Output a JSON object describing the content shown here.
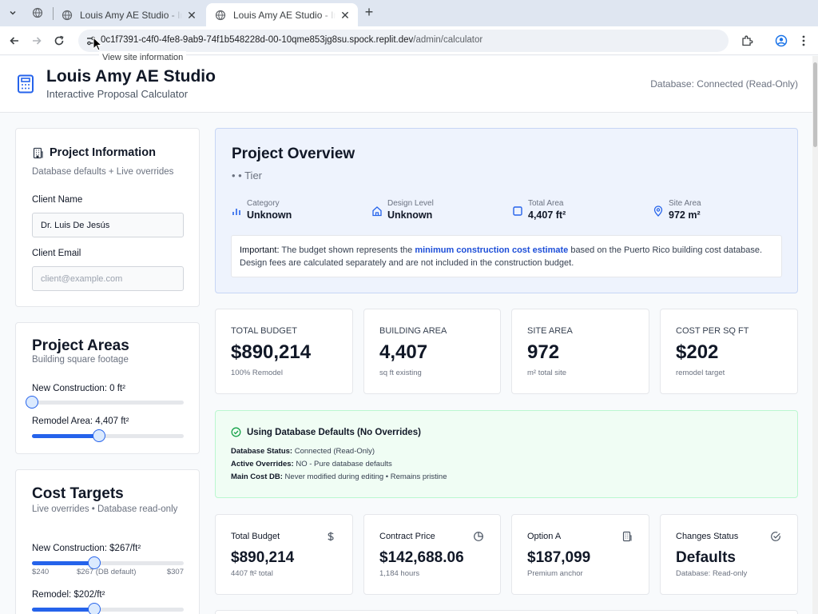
{
  "browser": {
    "tabs": [
      {
        "title": "Louis Amy AE Studio - Intera"
      },
      {
        "title": "Louis Amy AE Studio - Intera"
      }
    ],
    "url_host": "0c1f7391-c4f0-4fe8-9ab9-74f1b548228d-00-10qme853jg8su.spock.replit.dev",
    "url_path": "/admin/calculator",
    "tooltip": "View site information"
  },
  "header": {
    "title": "Louis Amy AE Studio",
    "subtitle": "Interactive Proposal Calculator",
    "db_status": "Database: Connected (Read-Only)"
  },
  "project_info": {
    "heading": "Project Information",
    "subheading": "Database defaults + Live overrides",
    "client_name_label": "Client Name",
    "client_name_value": "Dr. Luis De Jesús",
    "client_email_label": "Client Email",
    "client_email_placeholder": "client@example.com"
  },
  "project_areas": {
    "heading": "Project Areas",
    "subheading": "Building square footage",
    "new_construction_label": "New Construction: 0 ft²",
    "new_construction_fraction": 0.0,
    "remodel_label": "Remodel Area: 4,407 ft²",
    "remodel_fraction": 0.44
  },
  "cost_targets": {
    "heading": "Cost Targets",
    "subheading": "Live overrides • Database read-only",
    "new_construction_label": "New Construction: $267/ft²",
    "new_construction_fraction": 0.41,
    "ticks": [
      "$240",
      "$267 (DB default)",
      "$307"
    ],
    "remodel_label": "Remodel: $202/ft²",
    "remodel_fraction": 0.41
  },
  "overview": {
    "title": "Project Overview",
    "tier": "• • Tier",
    "stats": [
      {
        "label": "Category",
        "value": "Unknown",
        "icon": "bar-chart-icon"
      },
      {
        "label": "Design Level",
        "value": "Unknown",
        "icon": "home-icon"
      },
      {
        "label": "Total Area",
        "value": "4,407 ft²",
        "icon": "square-icon"
      },
      {
        "label": "Site Area",
        "value": "972 m²",
        "icon": "map-pin-icon"
      }
    ],
    "note_prefix": "Important:",
    "note_part1": " The budget shown represents the ",
    "note_highlight": "minimum construction cost estimate",
    "note_part2": " based on the Puerto Rico building cost database. Design fees are calculated separately and are not included in the construction budget."
  },
  "kpis": [
    {
      "label": "Total Budget",
      "value": "$890,214",
      "sub": "100% Remodel"
    },
    {
      "label": "Building Area",
      "value": "4,407",
      "sub": "sq ft existing"
    },
    {
      "label": "Site Area",
      "value": "972",
      "sub": "m² total site"
    },
    {
      "label": "Cost per Sq Ft",
      "value": "$202",
      "sub": "remodel target"
    }
  ],
  "defaults": {
    "heading": "Using Database Defaults (No Overrides)",
    "lines": [
      {
        "key": "Database Status:",
        "value": " Connected (Read-Only)"
      },
      {
        "key": "Active Overrides:",
        "value": " NO - Pure database defaults"
      },
      {
        "key": "Main Cost DB:",
        "value": " Never modified during editing • Remains pristine"
      }
    ]
  },
  "cards": [
    {
      "label": "Total Budget",
      "value": "$890,214",
      "sub": "4407 ft² total",
      "icon": "dollar-icon"
    },
    {
      "label": "Contract Price",
      "value": "$142,688.06",
      "sub": "1,184 hours",
      "icon": "pie-chart-icon"
    },
    {
      "label": "Option A",
      "value": "$187,099",
      "sub": "Premium anchor",
      "icon": "building-icon"
    },
    {
      "label": "Changes Status",
      "value": "Defaults",
      "sub": "Database: Read-only",
      "icon": "check-circle-icon"
    }
  ],
  "colors": {
    "accent": "#2563eb",
    "overview_bg": "#eef3fd",
    "success_bg": "#f0fdf4",
    "success_icon": "#16a34a"
  }
}
